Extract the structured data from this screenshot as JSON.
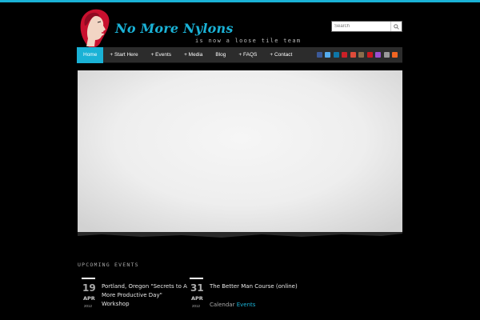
{
  "header": {
    "site_title": "No More Nylons",
    "tagline": "is now a loose tile team",
    "brand_color": "#1ab2d6"
  },
  "search": {
    "placeholder": "Search",
    "button_icon": "search-icon"
  },
  "nav": {
    "items": [
      {
        "label": "Home",
        "active": true
      },
      {
        "label": "+ Start Here"
      },
      {
        "label": "+ Events"
      },
      {
        "label": "+ Media"
      },
      {
        "label": "Blog"
      },
      {
        "label": "+ FAQS"
      },
      {
        "label": "+ Contact"
      }
    ],
    "social_icons": [
      {
        "icon": "facebook-icon",
        "color": "#3b5998"
      },
      {
        "icon": "twitter-icon",
        "color": "#55acee"
      },
      {
        "icon": "linkedin-icon",
        "color": "#0e76a8"
      },
      {
        "icon": "pinterest-icon",
        "color": "#cb2027"
      },
      {
        "icon": "google-plus-icon",
        "color": "#dd4b39"
      },
      {
        "icon": "instagram-icon",
        "color": "#8a6d4b"
      },
      {
        "icon": "youtube-icon",
        "color": "#cc181e"
      },
      {
        "icon": "flickr-icon",
        "color": "#9c4fd1"
      },
      {
        "icon": "email-icon",
        "color": "#9a9a9a"
      },
      {
        "icon": "rss-icon",
        "color": "#f26522"
      }
    ]
  },
  "events_section": {
    "heading": "UPCOMING EVENTS",
    "events": [
      {
        "day": "19",
        "month": "APR",
        "year": "2012",
        "title": "Portland, Oregon \"Secrets to A More Productive Day\" Workshop",
        "link_prefix": "",
        "link_text": ""
      },
      {
        "day": "31",
        "month": "APR",
        "year": "2012",
        "title": "The Better Man Course (online)",
        "link_prefix": "Calendar",
        "link_text": "Events"
      }
    ]
  }
}
